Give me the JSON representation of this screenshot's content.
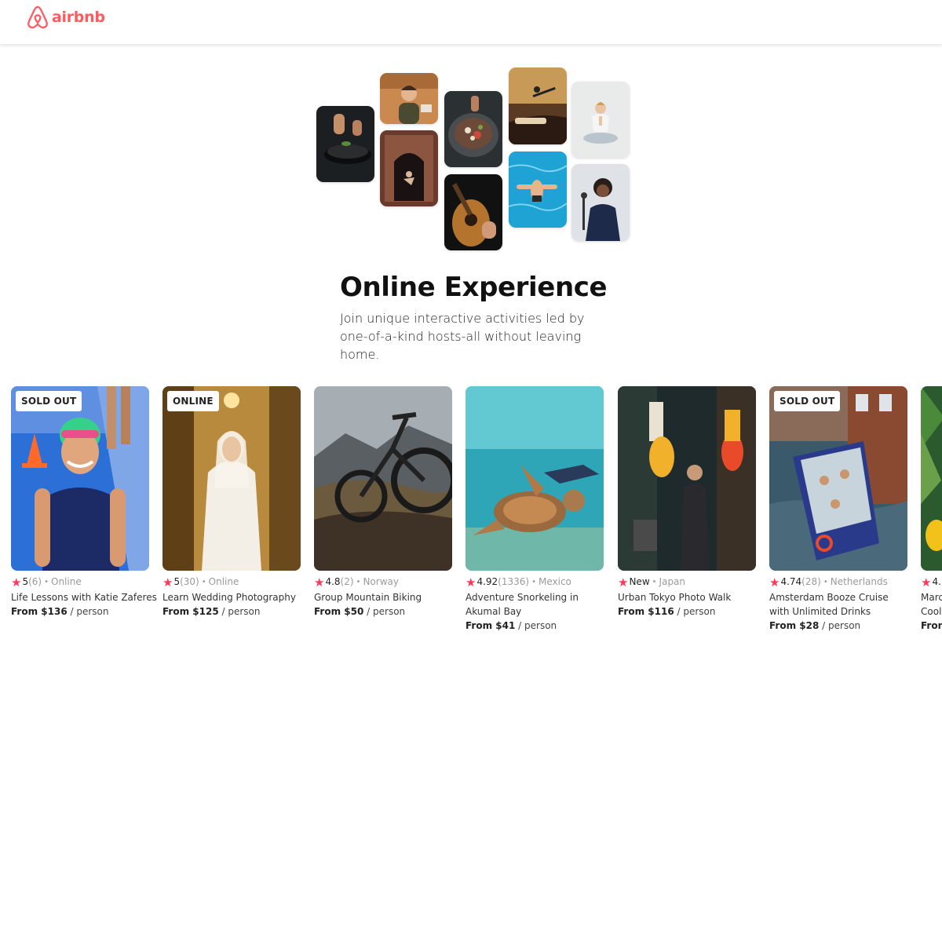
{
  "brand": {
    "name": "airbnb",
    "color": "#ff5a5f"
  },
  "hero": {
    "title": "Online Experience",
    "subtitle": "Join unique interactive activities led by one-of-a-kind hosts-all without leaving home."
  },
  "collage": [
    {
      "name": "photo-cooking-pan"
    },
    {
      "name": "photo-woman-portrait"
    },
    {
      "name": "photo-arched-doorway-dancer"
    },
    {
      "name": "photo-food-bowl"
    },
    {
      "name": "photo-acoustic-guitar"
    },
    {
      "name": "photo-microphone-performer"
    },
    {
      "name": "photo-swimmer-pool"
    },
    {
      "name": "photo-yoga-meditation"
    },
    {
      "name": "photo-singer-concert"
    }
  ],
  "star_glyph": "★",
  "per_label": "/ person",
  "cards": [
    {
      "badge": "SOLD OUT",
      "rating": "5",
      "count": "(6)",
      "location": "Online",
      "title": "Life Lessons with Katie Zaferes",
      "price": "From $136"
    },
    {
      "badge": "ONLINE",
      "rating": "5",
      "count": "(30)",
      "location": "Online",
      "title": "Learn Wedding Photography",
      "price": "From $125"
    },
    {
      "badge": "",
      "rating": "4.8",
      "count": "(2)",
      "location": "Norway",
      "title": "Group Mountain Biking",
      "price": "From $50"
    },
    {
      "badge": "",
      "rating": "4.92",
      "count": "(1336)",
      "location": "Mexico",
      "title": "Adventure Snorkeling in Akumal Bay",
      "price": "From $41"
    },
    {
      "badge": "",
      "rating": "New",
      "count": "",
      "location": "Japan",
      "title": "Urban Tokyo Photo Walk",
      "price": "From $116"
    },
    {
      "badge": "SOLD OUT",
      "rating": "4.74",
      "count": "(28)",
      "location": "Netherlands",
      "title": "Amsterdam Booze Cruise with Unlimited Drinks",
      "price": "From $28"
    },
    {
      "badge": "",
      "rating": "4.",
      "count": "",
      "location": "",
      "title": "Marc",
      "title2": "Cool",
      "price": "Fron"
    }
  ]
}
